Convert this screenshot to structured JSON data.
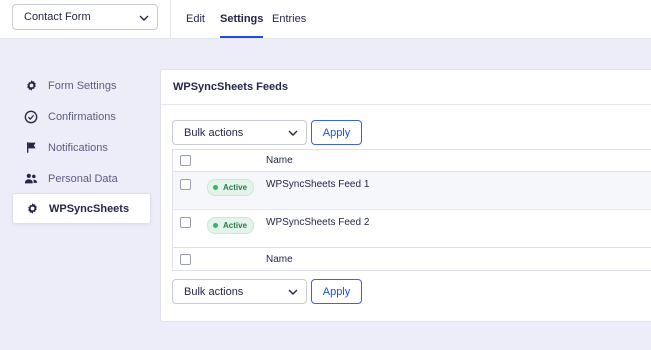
{
  "header": {
    "form_selector": "Contact Form",
    "tabs": [
      {
        "label": "Edit"
      },
      {
        "label": "Settings"
      },
      {
        "label": "Entries"
      }
    ]
  },
  "sidebar": {
    "items": [
      {
        "label": "Form Settings",
        "icon": "gear-icon"
      },
      {
        "label": "Confirmations",
        "icon": "check-circle-icon"
      },
      {
        "label": "Notifications",
        "icon": "flag-icon"
      },
      {
        "label": "Personal Data",
        "icon": "users-icon"
      },
      {
        "label": "WPSyncSheets",
        "icon": "gear-icon"
      }
    ]
  },
  "panel": {
    "title": "WPSyncSheets Feeds",
    "bulk_actions": "Bulk actions",
    "apply": "Apply",
    "column_name": "Name",
    "rows": [
      {
        "status": "Active",
        "name": "WPSyncSheets Feed 1"
      },
      {
        "status": "Active",
        "name": "WPSyncSheets Feed 2"
      }
    ]
  },
  "colors": {
    "accent": "#204ce5",
    "active_badge_bg": "#e3f4ea",
    "active_dot": "#37b26a"
  }
}
